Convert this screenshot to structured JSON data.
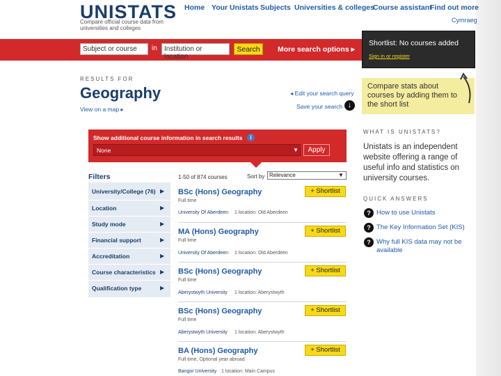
{
  "header": {
    "logo": "UNISTATS",
    "tagline": "Compare official course data from universities and colleges",
    "nav": [
      "Home",
      "Your Unistats",
      "Subjects",
      "Universities & colleges",
      "Course assistant",
      "Find out more"
    ],
    "language": "Cymraeg"
  },
  "search": {
    "subject_value": "Subject or course",
    "in_label": "in",
    "institution_value": "Institution or location",
    "search_label": "Search",
    "more_options": "More search options ▸"
  },
  "shortlist": {
    "title": "Shortlist: No courses added",
    "signin": "Sign in or register"
  },
  "compare_note": "Compare stats about courses by adding them to the short list",
  "results": {
    "label": "RESULTS FOR",
    "title": "Geography",
    "view_map": "View on a map ▸",
    "edit_query": "◂ Edit your search query",
    "save_search": "Save your search"
  },
  "info_panel": {
    "label": "Show additional course information in search results",
    "info_icon": "i",
    "select_value": "None",
    "apply_label": "Apply"
  },
  "filters": {
    "title": "Filters",
    "items": [
      "University/College (76)",
      "Location",
      "Study mode",
      "Financial support",
      "Accreditation",
      "Course characteristics",
      "Qualification type"
    ]
  },
  "list": {
    "count": "1-50 of 874 courses",
    "sort_label": "Sort by",
    "sort_value": "Relevance",
    "shortlist_label": "+ Shortlist",
    "courses": [
      {
        "title": "BSc (Hons) Geography",
        "mode": "Full time",
        "institution": "University Of Aberdeen",
        "location": "1 location: Old Aberdeen"
      },
      {
        "title": "MA (Hons) Geography",
        "mode": "Full time",
        "institution": "University Of Aberdeen",
        "location": "1 location: Old Aberdeen"
      },
      {
        "title": "BSc (Hons) Geography",
        "mode": "Full time",
        "institution": "Aberystwyth University",
        "location": "1 location: Aberystwyth"
      },
      {
        "title": "BSc (Hons) Geography",
        "mode": "Full time",
        "institution": "Aberystwyth University",
        "location": "1 location: Aberystwyth"
      },
      {
        "title": "BA (Hons) Geography",
        "mode": "Full time, Optional year abroad",
        "institution": "Bangor University",
        "location": "1 location: Main Campus"
      }
    ]
  },
  "sidebar": {
    "what_is_title": "WHAT IS UNISTATS?",
    "what_is_text": "Unistats is an independent website offering a range of useful info and statistics on university courses.",
    "quick_title": "QUICK ANSWERS",
    "quick_links": [
      "How to use Unistats",
      "The Key Information Set (KIS)",
      "Why full KIS data may not be available"
    ]
  },
  "colors": {
    "brand_blue": "#1a3e6b",
    "link_blue": "#1f5aa6",
    "accent_red": "#d2292b",
    "button_yellow": "#f7d917"
  }
}
